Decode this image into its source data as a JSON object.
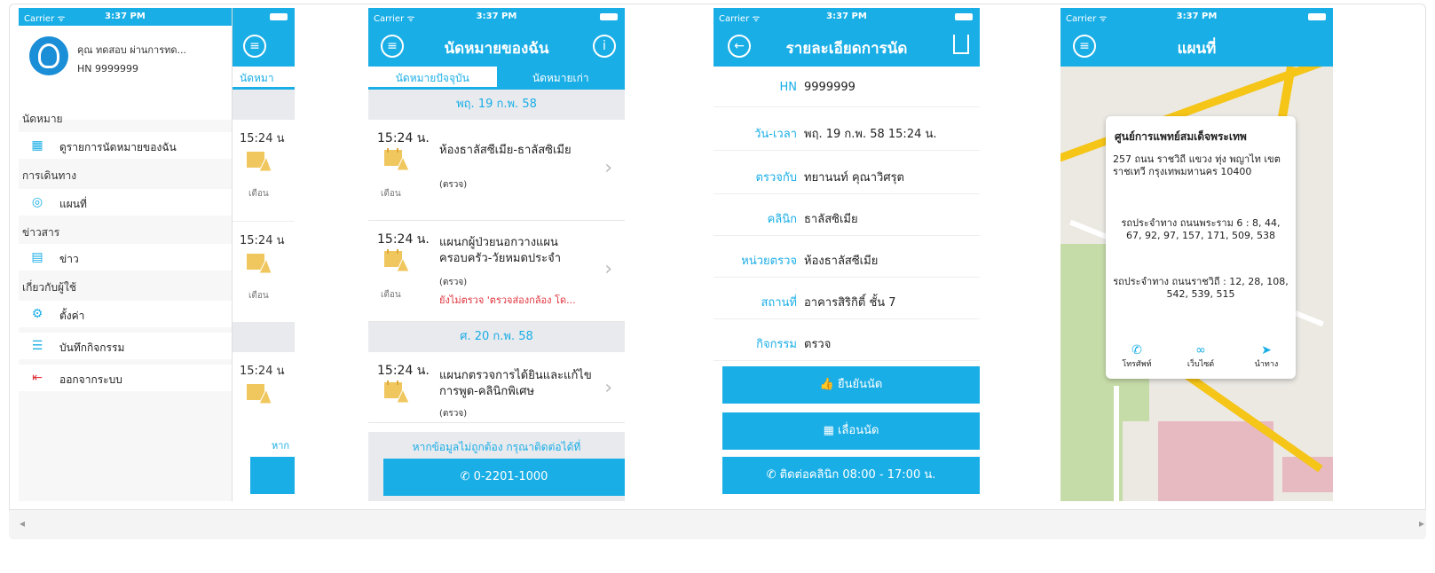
{
  "common": {
    "carrier": "Carrier ᯤ",
    "time": "3:37 PM",
    "reminder_label": "เตือน",
    "exam_label": "(ตรวจ)",
    "chevron": "›"
  },
  "screen1": {
    "profile_name": "คุณ ทดสอบ ผ่านการทด...",
    "hn": "HN 9999999",
    "sections": [
      {
        "label": "นัดหมาย",
        "items": [
          {
            "label": "ดูรายการนัดหมายของฉัน",
            "icon": "calendar-icon"
          }
        ]
      },
      {
        "label": "การเดินทาง",
        "items": [
          {
            "label": "แผนที่",
            "icon": "map-pin-icon"
          }
        ]
      },
      {
        "label": "ข่าวสาร",
        "items": [
          {
            "label": "ข่าว",
            "icon": "news-icon"
          }
        ]
      },
      {
        "label": "เกี่ยวกับผู้ใช้",
        "items": [
          {
            "label": "ตั้งค่า",
            "icon": "gear-icon"
          },
          {
            "label": "บันทึกกิจกรรม",
            "icon": "database-icon"
          },
          {
            "label": "ออกจากระบบ",
            "icon": "logout-icon"
          }
        ]
      }
    ],
    "peek": {
      "tab": "นัดหมา",
      "times": [
        "15:24 น",
        "15:24 น",
        "15:24 น"
      ],
      "footer": "หาก"
    }
  },
  "screen2": {
    "title": "นัดหมายของฉัน",
    "tabs": {
      "current": "นัดหมายปัจจุบัน",
      "past": "นัดหมายเก่า"
    },
    "date1": "พฤ. 19 ก.พ. 58",
    "date2": "ศ. 20 ก.พ. 58",
    "appointments": [
      {
        "time": "15:24 น.",
        "room": "ห้องธาลัสซีเมีย-ธาลัสซิเมีย",
        "note": ""
      },
      {
        "time": "15:24 น.",
        "room": "แผนกผู้ป่วยนอกวางแผนครอบครัว-วัยหมดประจำ",
        "note": "ยังไม่ตรวจ 'ตรวจส่องกล้อง โด..."
      },
      {
        "time": "15:24 น.",
        "room": "แผนกตรวจการได้ยินและแก้ไขการพูด-คลินิกพิเศษ",
        "note": ""
      }
    ],
    "footer_note": "หากข้อมูลไม่ถูกต้อง กรุณาติดต่อได้ที่",
    "call_label": "0-2201-1000"
  },
  "screen3": {
    "title": "รายละเอียดการนัด",
    "rows": [
      {
        "label": "HN",
        "value": "9999999"
      },
      {
        "label": "วัน-เวลา",
        "value": "พฤ. 19 ก.พ. 58 15:24 น."
      },
      {
        "label": "ตรวจกับ",
        "value": "ทยานนท์ คุณาวิศรุต"
      },
      {
        "label": "คลินิก",
        "value": "ธาลัสซิเมีย"
      },
      {
        "label": "หน่วยตรวจ",
        "value": "ห้องธาลัสซีเมีย"
      },
      {
        "label": "สถานที่",
        "value": "อาคารสิริกิติ์ ชั้น 7"
      },
      {
        "label": "กิจกรรม",
        "value": "ตรวจ"
      }
    ],
    "confirm_label": "ยืนยันนัด",
    "postpone_label": "เลื่อนนัด",
    "contact_label": "ติดต่อคลินิก 08:00 - 17:00 น."
  },
  "screen4": {
    "title": "แผนที่",
    "card": {
      "name": "ศูนย์การแพทย์สมเด็จพระเทพ",
      "address": "257 ถนน ราชวิถี แขวง ทุ่ง พญาไท เขต ราชเทวี กรุงเทพมหานคร 10400",
      "bus1": "รถประจำทาง ถนนพระราม 6 : 8, 44, 67, 92, 97, 157, 171, 509, 538",
      "bus2": "รถประจำทาง ถนนราชวิถี : 12, 28, 108, 542, 539, 515",
      "actions": [
        "โทรศัพท์",
        "เว็บไซต์",
        "นำทาง"
      ]
    }
  }
}
